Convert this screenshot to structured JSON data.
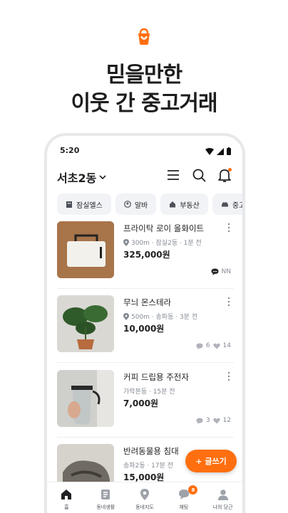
{
  "headline": {
    "line1": "믿을만한",
    "line2": "이웃 간 중고거래"
  },
  "status_bar": {
    "time": "5:20"
  },
  "top_bar": {
    "location": "서초2동"
  },
  "chips": [
    "잠실엘스",
    "알바",
    "부동산",
    "중고차"
  ],
  "items": [
    {
      "title": "프라이탁 로이 올화이트",
      "meta": "300m · 잠실2동 · 1분 전",
      "price": "325,000원",
      "chat_label": "NN",
      "comments": "",
      "likes": ""
    },
    {
      "title": "무늬 몬스테라",
      "meta": "500m · 송파동 · 3분 전",
      "price": "10,000원",
      "chat_label": "",
      "comments": "6",
      "likes": "14"
    },
    {
      "title": "커피 드립용 주전자",
      "meta": "가락본동 · 15분 전",
      "price": "7,000원",
      "chat_label": "",
      "comments": "3",
      "likes": "12"
    },
    {
      "title": "반려동물용 침대",
      "meta": "송파2동 · 17분 전",
      "price": "15,000원",
      "chat_label": "",
      "comments": "",
      "likes": ""
    }
  ],
  "fab": {
    "label": "+ 글쓰기"
  },
  "tabs": [
    {
      "label": "홈"
    },
    {
      "label": "동네생활"
    },
    {
      "label": "동네지도"
    },
    {
      "label": "채팅",
      "badge": "8"
    },
    {
      "label": "나의 당근"
    }
  ],
  "colors": {
    "accent": "#ff6f0f",
    "text": "#212124",
    "muted": "#868b94",
    "chip_bg": "#f2f3f6"
  }
}
